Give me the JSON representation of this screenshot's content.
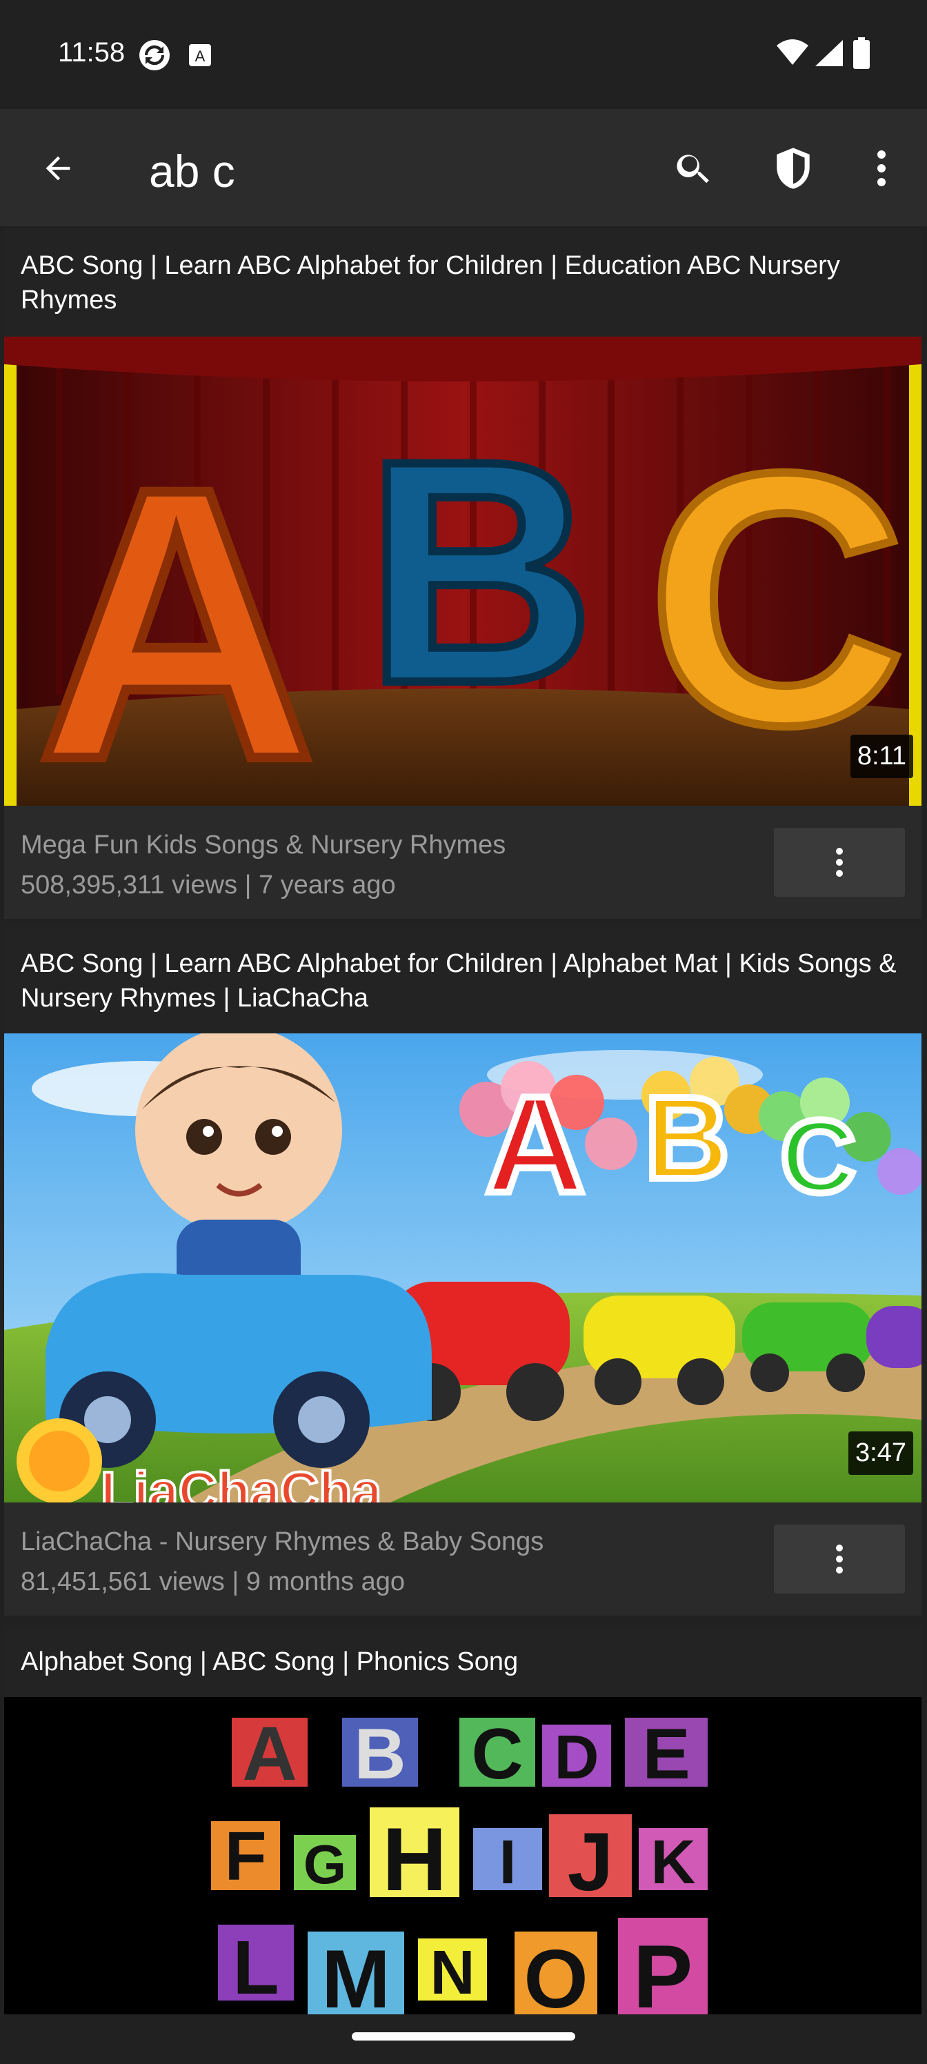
{
  "status": {
    "time": "11:58"
  },
  "toolbar": {
    "query": "ab c",
    "back_icon": "arrow-back-icon",
    "search_icon": "search-icon",
    "shield_icon": "shield-icon",
    "more_icon": "more-vert-icon"
  },
  "videos": [
    {
      "title": "ABC Song | Learn ABC Alphabet for Children | Education ABC Nursery Rhymes",
      "duration": "8:11",
      "channel": "Mega Fun Kids Songs & Nursery Rhymes",
      "stats": "508,395,311 views   |   7 years ago"
    },
    {
      "title": "ABC Song | Learn ABC Alphabet for Children | Alphabet Mat | Kids Songs & Nursery Rhymes | LiaChaCha",
      "duration": "3:47",
      "channel": "LiaChaCha - Nursery Rhymes & Baby Songs",
      "stats": "81,451,561 views   |   9 months ago"
    },
    {
      "title": "Alphabet Song | ABC Song | Phonics Song"
    }
  ],
  "thumb2_logo": "LiaChaCha",
  "thumb3_letters": [
    "A",
    "B",
    "C",
    "D",
    "E",
    "F",
    "G",
    "H",
    "I",
    "J",
    "K",
    "L",
    "M",
    "N",
    "O",
    "P"
  ],
  "thumb1_letters": [
    "A",
    "B",
    "C"
  ]
}
